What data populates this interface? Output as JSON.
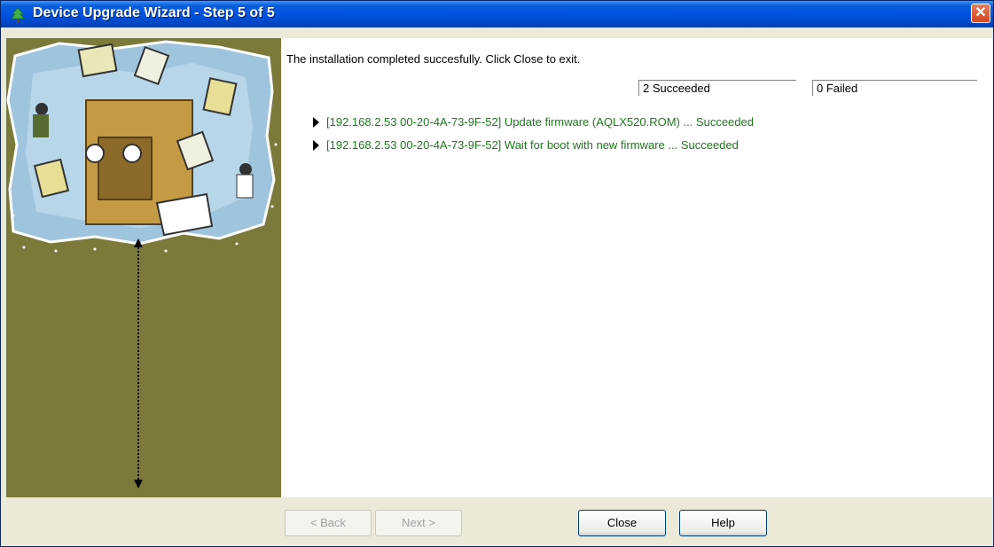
{
  "window": {
    "title": "Device Upgrade Wizard - Step 5 of 5",
    "close_glyph": "✕",
    "icon": "tree-icon"
  },
  "content": {
    "message": "The installation completed succesfully.  Click Close to exit.",
    "succeeded_count": "2 Succeeded",
    "failed_count": "0 Failed",
    "log_items": [
      "[192.168.2.53 00-20-4A-73-9F-52] Update firmware (AQLX520.ROM) ... Succeeded",
      "[192.168.2.53 00-20-4A-73-9F-52] Wait for boot with new firmware ... Succeeded"
    ],
    "log_color": "#1b7a1b"
  },
  "buttons": {
    "back": "< Back",
    "next": "Next >",
    "close": "Close",
    "help": "Help"
  },
  "colors": {
    "titlebar": "#0054e3",
    "sidebar": "#7c7a3b",
    "close_button": "#d1461e"
  }
}
